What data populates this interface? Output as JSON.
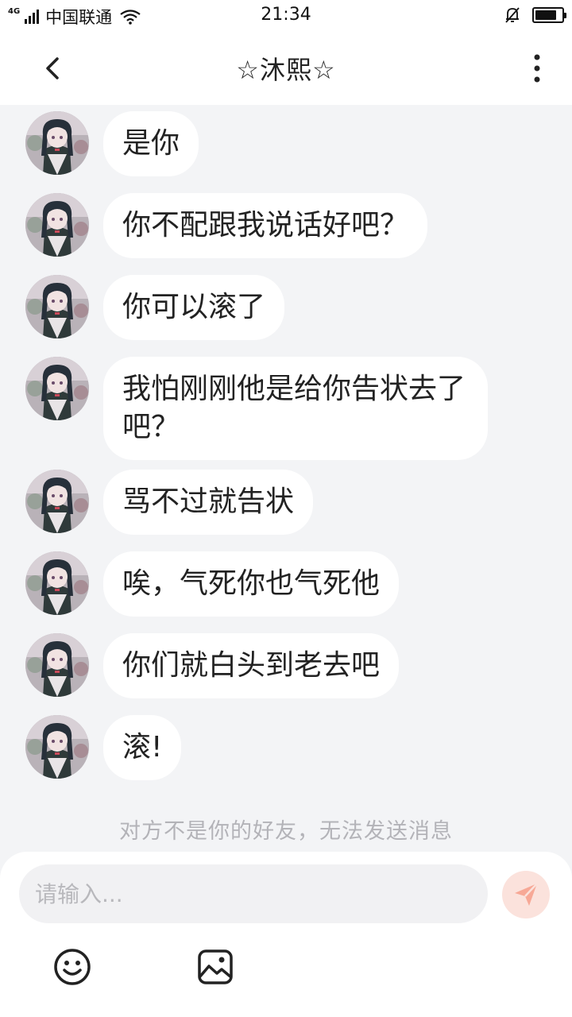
{
  "status_bar": {
    "network": "4G",
    "carrier": "中国联通",
    "time": "21:34",
    "battery_level": 0.8
  },
  "header": {
    "title": "☆沐熙☆",
    "back_icon": "chevron-left-icon",
    "more_icon": "more-vertical-icon"
  },
  "messages": [
    {
      "text": "是你"
    },
    {
      "text": "你不配跟我说话好吧？"
    },
    {
      "text": "你可以滚了"
    },
    {
      "text": "我怕刚刚他是给你告状去了吧？"
    },
    {
      "text": "骂不过就告状"
    },
    {
      "text": "唉，气死你也气死他"
    },
    {
      "text": "你们就白头到老去吧"
    },
    {
      "text": "滚!"
    }
  ],
  "notice": "对方不是你的好友，无法发送消息",
  "composer": {
    "placeholder": "请输入...",
    "send_icon": "paper-plane-icon",
    "emoji_icon": "smiley-icon",
    "image_icon": "image-icon"
  },
  "colors": {
    "background": "#f3f4f6",
    "bubble": "#ffffff",
    "send_button": "#fbe2dc",
    "send_icon": "#f7a896",
    "notice_text": "#b3b3b8"
  }
}
